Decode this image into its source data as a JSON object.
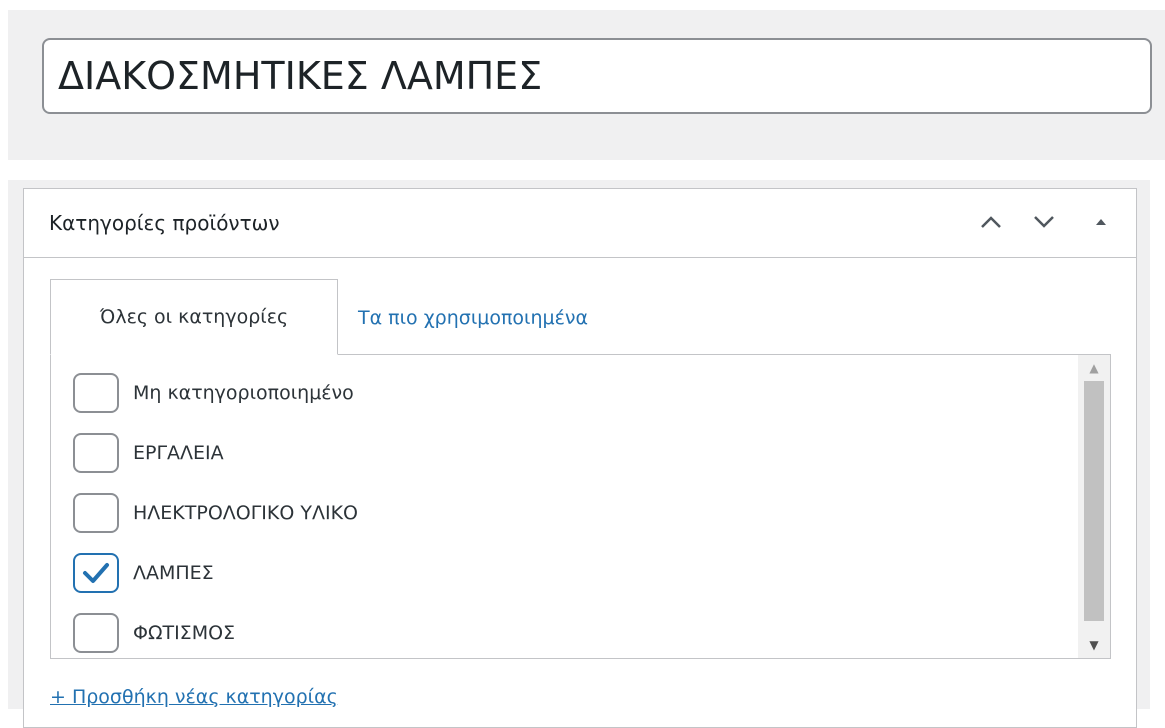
{
  "post_title": {
    "value": "ΔΙΑΚΟΣΜΗΤΙΚΕΣ ΛΑΜΠΕΣ"
  },
  "metabox": {
    "title": "Κατηγορίες προϊόντων",
    "buttons": [
      "chevron-up-icon",
      "chevron-down-icon",
      "triangle-up-icon"
    ]
  },
  "tabs": {
    "all_label": "Όλες οι κατηγορίες",
    "popular_label": "Τα πιο χρησιμοποιημένα"
  },
  "categories": [
    {
      "label": "Μη κατηγοριοποιημένο",
      "checked": false
    },
    {
      "label": "ΕΡΓΑΛΕΙΑ",
      "checked": false
    },
    {
      "label": "ΗΛΕΚΤΡΟΛΟΓΙΚΟ ΥΛΙΚΟ",
      "checked": false
    },
    {
      "label": "ΛΑΜΠΕΣ",
      "checked": true
    },
    {
      "label": "ΦΩΤΙΣΜΟΣ",
      "checked": false
    }
  ],
  "add_category_link": "+ Προσθήκη νέας κατηγορίας",
  "colors": {
    "link": "#2271b1",
    "border": "#c3c4c7",
    "background": "#f0f0f1"
  }
}
